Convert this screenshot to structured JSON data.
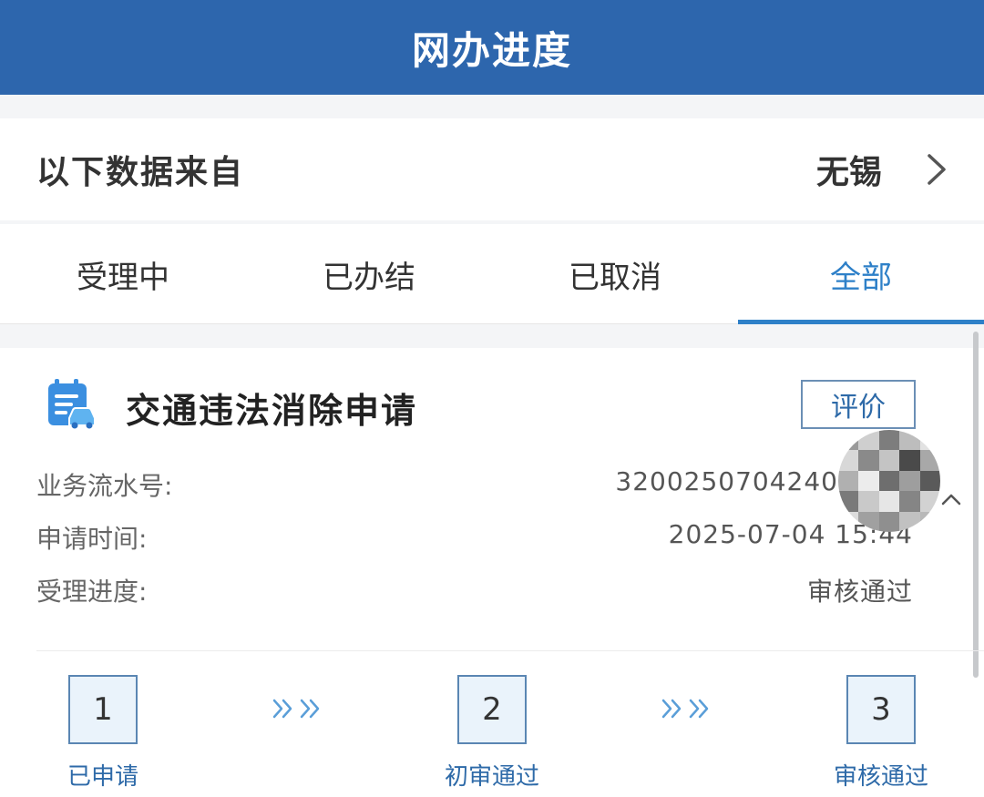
{
  "header": {
    "title": "网办进度"
  },
  "source": {
    "label": "以下数据来自",
    "city": "无锡",
    "chevron_icon": "chevron-right-icon"
  },
  "tabs": [
    {
      "label": "受理中",
      "active": false
    },
    {
      "label": "已办结",
      "active": false
    },
    {
      "label": "已取消",
      "active": false
    },
    {
      "label": "全部",
      "active": true
    }
  ],
  "card": {
    "icon": "calendar-car-icon",
    "title": "交通违法消除申请",
    "rate_button": "评价",
    "fields": [
      {
        "label": "业务流水号:",
        "value": "3200250704240"
      },
      {
        "label": "申请时间:",
        "value": "2025-07-04 15:44"
      },
      {
        "label": "受理进度:",
        "value": "审核通过"
      }
    ],
    "steps": [
      {
        "number": "1",
        "label": "已申请"
      },
      {
        "number": "2",
        "label": "初审通过"
      },
      {
        "number": "3",
        "label": "审核通过"
      }
    ]
  },
  "colors": {
    "header": "#2d66ad",
    "accent": "#2e80c8",
    "step_border": "#5a86b3"
  }
}
